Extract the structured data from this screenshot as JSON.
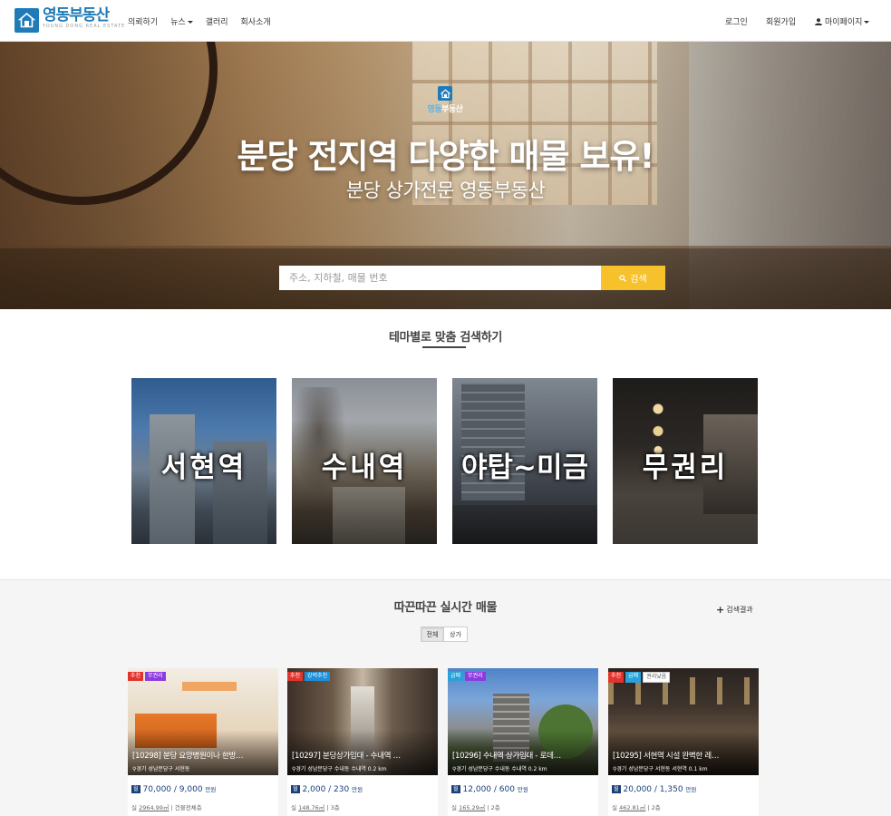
{
  "brand": {
    "name": "영동부동산",
    "subtitle": "YOUNG DONG REAL ESTATE",
    "accent": "#1f7bb8"
  },
  "nav": {
    "left": [
      "의뢰하기",
      "뉴스",
      "갤러리",
      "회사소개"
    ],
    "login": "로그인",
    "signup": "회원가입",
    "mypage": "마이페이지"
  },
  "hero": {
    "logo_a": "영동",
    "logo_b": "부동산",
    "title": "분당 전지역 다양한 매물 보유!",
    "subtitle": "분당 상가전문 영동부동산",
    "search_placeholder": "주소, 지하철, 매물 번호",
    "search_button": "검색",
    "search_button_color": "#f6c12a"
  },
  "themes": {
    "title": "테마별로 맞춤 검색하기",
    "items": [
      "서현역",
      "수내역",
      "야탑~미금",
      "무권리"
    ]
  },
  "listings": {
    "title": "따끈따끈 실시간 매물",
    "more": "검색결과",
    "filters": [
      "전체",
      "상가"
    ],
    "cards": [
      {
        "badges": [
          "추천",
          "무권리"
        ],
        "title": "[10298] 분당 요양병원이나 한방…",
        "location": "경기 성남분당구 서현동",
        "price_tag": "월",
        "price": "70,000 / 9,000",
        "price_unit": "만원",
        "area_prefix": "실",
        "area": "2964.99㎡",
        "floor": "| 건물전체층"
      },
      {
        "badges": [
          "추천",
          "강력추천"
        ],
        "title": "[10297] 분당상가임대 - 수내역 …",
        "location": "경기 성남분당구 수내동  수내역  0.2 km",
        "price_tag": "월",
        "price": "2,000 / 230",
        "price_unit": "만원",
        "area_prefix": "실",
        "area": "148.76㎡",
        "floor": "| 3층"
      },
      {
        "badges": [
          "급매",
          "무권리"
        ],
        "title": "[10296] 수내역 상가임대 - 로데…",
        "location": "경기 성남분당구 수내동  수내역  0.2 km",
        "price_tag": "월",
        "price": "12,000 / 600",
        "price_unit": "만원",
        "area_prefix": "실",
        "area": "165.29㎡",
        "floor": "| 2층"
      },
      {
        "badges": [
          "추천",
          "급매",
          "권리낮음"
        ],
        "title": "[10295] 서현역 시설 완벽한 레…",
        "location": "경기 성남분당구 서현동  서현역  0.1 km",
        "price_tag": "월",
        "price": "20,000 / 1,350",
        "price_unit": "만원",
        "area_prefix": "실",
        "area": "462.81㎡",
        "floor": "| 2층"
      }
    ]
  }
}
